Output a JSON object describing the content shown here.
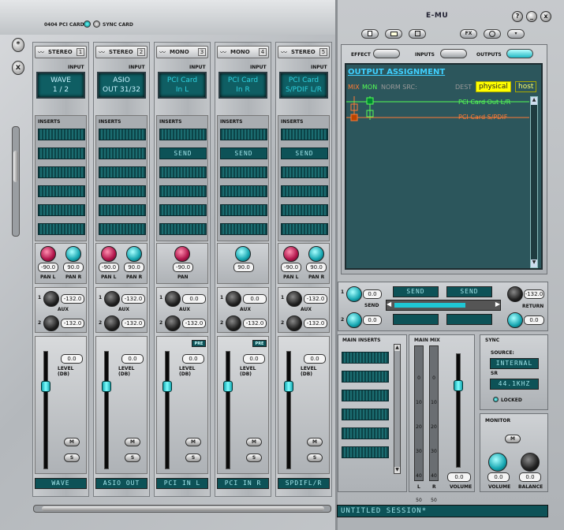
{
  "header": {
    "pci_card": "0404 PCI CARD",
    "sync_card": "SYNC CARD",
    "logo": "E-MU",
    "win_help": "?",
    "win_minimize": "_",
    "win_close": "x",
    "toolbar_buttons": [
      "",
      "",
      "",
      "FX",
      "",
      "▾"
    ]
  },
  "side": {
    "btn1": "*",
    "btn2": "x"
  },
  "labels": {
    "input": "INPUT",
    "inserts": "INSERTS",
    "aux": "AUX",
    "level": "LEVEL (DB)",
    "mute": "M",
    "solo": "S",
    "pre": "PRE",
    "pan_l": "PAN L",
    "pan_r": "PAN R",
    "pan": "PAN"
  },
  "strips": [
    {
      "type": "STEREO",
      "num": "1",
      "input_l1": "WAVE",
      "input_l2": "1 / 2",
      "teal": false,
      "slots": [
        "",
        "",
        "",
        "",
        "",
        ""
      ],
      "pan_l": "-90.0",
      "pan_r": "90.0",
      "stereo": true,
      "aux1": "-132.0",
      "aux2": "-132.0",
      "level": "0.0",
      "pre": false,
      "name": "WAVE"
    },
    {
      "type": "STEREO",
      "num": "2",
      "input_l1": "ASIO",
      "input_l2": "OUT 31/32",
      "teal": false,
      "slots": [
        "",
        "",
        "",
        "",
        "",
        ""
      ],
      "pan_l": "-90.0",
      "pan_r": "90.0",
      "stereo": true,
      "aux1": "-132.0",
      "aux2": "-132.0",
      "level": "0.0",
      "pre": false,
      "name": "ASIO OUT"
    },
    {
      "type": "MONO",
      "num": "3",
      "input_l1": "PCI Card",
      "input_l2": "In L",
      "teal": true,
      "slots": [
        "",
        "SEND",
        "",
        "",
        "",
        ""
      ],
      "pan_l": "-90.0",
      "pan_r": "",
      "stereo": false,
      "aux1": "0.0",
      "aux2": "-132.0",
      "level": "0.0",
      "pre": true,
      "name": "PCI IN L"
    },
    {
      "type": "MONO",
      "num": "4",
      "input_l1": "PCI Card",
      "input_l2": "In R",
      "teal": true,
      "slots": [
        "",
        "SEND",
        "",
        "",
        "",
        ""
      ],
      "pan_l": "",
      "pan_r": "90.0",
      "stereo": false,
      "aux1": "0.0",
      "aux2": "-132.0",
      "level": "0.0",
      "pre": true,
      "name": "PCI IN R"
    },
    {
      "type": "STEREO",
      "num": "5",
      "input_l1": "PCI Card",
      "input_l2": "S/PDIF L/R",
      "teal": true,
      "slots": [
        "",
        "SEND",
        "",
        "",
        "",
        ""
      ],
      "pan_l": "-90.0",
      "pan_r": "90.0",
      "stereo": true,
      "aux1": "-132.0",
      "aux2": "-132.0",
      "level": "0.0",
      "pre": false,
      "name": "SPDIFL/R"
    }
  ],
  "right": {
    "tab_effect": "EFFECT",
    "tab_inputs": "INPUTS",
    "tab_outputs": "OUTPUTS",
    "oa_title": "OUTPUT ASSIGNMENT",
    "mix": "MIX",
    "mon": "MON",
    "norm_src": "NORM SRC:",
    "dest": "DEST",
    "physical": "physical",
    "host": "host",
    "route1": "PCI Card Out L/R",
    "route2": "PCI Card S/PDIF",
    "aux_in1": "0.0",
    "aux_in2": "0.0",
    "send_label": "SEND",
    "send1": "SEND",
    "send2": "SEND",
    "return_label": "RETURN",
    "ret1": "-132.0",
    "ret2": "0.0",
    "main_inserts": "MAIN INSERTS",
    "main_mix": "MAIN MIX",
    "vu_scale": [
      "0",
      "10",
      "20",
      "30",
      "40",
      "50"
    ],
    "vu_l": "L",
    "vu_r": "R",
    "volume": "VOLUME",
    "volume_val": "0.0",
    "sync": "SYNC",
    "source": "SOURCE:",
    "source_val": "INTERNAL",
    "sr": "SR",
    "sr_val": "44.1KHZ",
    "locked": "LOCKED",
    "monitor": "MONITOR",
    "mon_m": "M",
    "mon_volume": "VOLUME",
    "mon_balance": "BALANCE",
    "mon_vol_val": "0.0",
    "mon_bal_val": "0.0",
    "session": "UNTITLED SESSION*"
  }
}
